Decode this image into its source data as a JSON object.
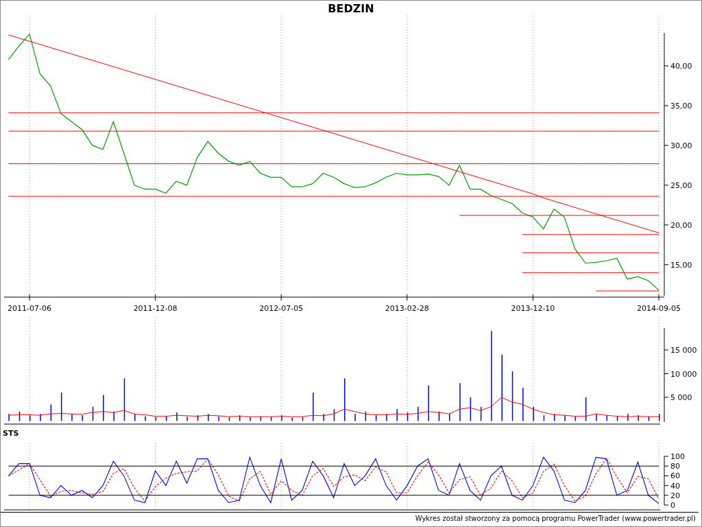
{
  "title": "BEDZIN",
  "price_chart": {
    "chart_data": {
      "type": "line",
      "categories": [
        null,
        null,
        "2011-07-06",
        null,
        null,
        null,
        null,
        null,
        null,
        null,
        null,
        null,
        null,
        null,
        "2011-12-08",
        null,
        null,
        null,
        null,
        null,
        null,
        null,
        null,
        null,
        null,
        null,
        "2012-07-05",
        null,
        null,
        null,
        null,
        null,
        null,
        null,
        null,
        null,
        null,
        null,
        "2013-02-28",
        null,
        null,
        null,
        null,
        null,
        null,
        null,
        null,
        null,
        null,
        null,
        "2013-12-10",
        null,
        null,
        null,
        null,
        null,
        null,
        null,
        null,
        null,
        null,
        null,
        "2014-09-05"
      ],
      "series": [
        {
          "color": "#00a000",
          "values": [
            40.8,
            42.5,
            44,
            39,
            37.5,
            34,
            33,
            32,
            30,
            29.5,
            33,
            29,
            25,
            24.5,
            24.5,
            24,
            25.5,
            25,
            28.5,
            30.5,
            29,
            28,
            27.5,
            28,
            26.5,
            26,
            26,
            24.8,
            24.8,
            25.2,
            26.5,
            26,
            25.2,
            24.7,
            24.8,
            25.3,
            26,
            26.5,
            26.3,
            26.3,
            26.4,
            26.1,
            25,
            27.5,
            24.5,
            24.5,
            23.7,
            23.2,
            22.7,
            21.5,
            21,
            19.5,
            22,
            21,
            17,
            15.2,
            15.3,
            15.5,
            15.8,
            13.2,
            13.5,
            13,
            11.8
          ]
        },
        {
          "color": "#ff0000",
          "values": [
            43.9,
            43.5,
            43.1,
            42.7,
            42.3,
            41.9,
            41.5,
            41.1,
            40.7,
            40.3,
            39.9,
            39.5,
            39.1,
            38.7,
            38.3,
            37.9,
            37.5,
            37.1,
            36.7,
            36.3,
            35.9,
            35.5,
            35.1,
            34.7,
            34.3,
            33.9,
            33.5,
            33.1,
            32.7,
            32.3,
            31.9,
            31.5,
            31.1,
            30.7,
            30.3,
            29.9,
            29.5,
            29.1,
            28.7,
            28.3,
            27.9,
            27.5,
            27.1,
            26.7,
            26.3,
            25.9,
            25.5,
            25.1,
            24.7,
            24.3,
            23.9,
            23.4,
            23.0,
            22.6,
            22.2,
            21.8,
            21.4,
            21.0,
            20.6,
            20.2,
            19.8,
            19.4,
            19.0
          ]
        },
        {
          "color": "#ff0000",
          "values": [
            34.1,
            34.1,
            34.1,
            34.1,
            34.1,
            34.1,
            34.1,
            34.1,
            34.1,
            34.1,
            34.1,
            34.1,
            34.1,
            34.1,
            34.1,
            34.1,
            34.1,
            34.1,
            34.1,
            34.1,
            34.1,
            34.1,
            34.1,
            34.1,
            34.1,
            34.1,
            34.1,
            34.1,
            34.1,
            34.1,
            34.1,
            34.1,
            34.1,
            34.1,
            34.1,
            34.1,
            34.1,
            34.1,
            34.1,
            34.1,
            34.1,
            34.1,
            34.1,
            34.1,
            34.1,
            34.1,
            34.1,
            34.1,
            34.1,
            34.1,
            34.1,
            34.1,
            34.1,
            34.1,
            34.1,
            34.1,
            34.1,
            34.1,
            34.1,
            34.1,
            34.1,
            34.1,
            34.1
          ]
        },
        {
          "color": "#ff0000",
          "values": [
            31.8,
            31.8,
            31.8,
            31.8,
            31.8,
            31.8,
            31.8,
            31.8,
            31.8,
            31.8,
            31.8,
            31.8,
            31.8,
            31.8,
            31.8,
            31.8,
            31.8,
            31.8,
            31.8,
            31.8,
            31.8,
            31.8,
            31.8,
            31.8,
            31.8,
            31.8,
            31.8,
            31.8,
            31.8,
            31.8,
            31.8,
            31.8,
            31.8,
            31.8,
            31.8,
            31.8,
            31.8,
            31.8,
            31.8,
            31.8,
            31.8,
            31.8,
            31.8,
            31.8,
            31.8,
            31.8,
            31.8,
            31.8,
            31.8,
            31.8,
            31.8,
            31.8,
            31.8,
            31.8,
            31.8,
            31.8,
            31.8,
            31.8,
            31.8,
            31.8,
            31.8,
            31.8,
            31.8
          ]
        },
        {
          "color": "#ff0000",
          "values": [
            27.7,
            27.7,
            27.7,
            27.7,
            27.7,
            27.7,
            27.7,
            27.7,
            27.7,
            27.7,
            27.7,
            27.7,
            27.7,
            27.7,
            27.7,
            27.7,
            27.7,
            27.7,
            27.7,
            27.7,
            27.7,
            27.7,
            27.7,
            27.7,
            27.7,
            27.7,
            27.7,
            27.7,
            27.7,
            27.7,
            27.7,
            27.7,
            27.7,
            27.7,
            27.7,
            27.7,
            27.7,
            27.7,
            27.7,
            27.7,
            27.7,
            27.7,
            27.7,
            27.7,
            27.7,
            27.7,
            27.7,
            27.7,
            27.7,
            27.7,
            27.7,
            27.7,
            27.7,
            27.7,
            27.7,
            27.7,
            27.7,
            27.7,
            27.7,
            27.7,
            27.7,
            27.7,
            27.7
          ]
        },
        {
          "color": "#ff0000",
          "values": [
            23.6,
            23.6,
            23.6,
            23.6,
            23.6,
            23.6,
            23.6,
            23.6,
            23.6,
            23.6,
            23.6,
            23.6,
            23.6,
            23.6,
            23.6,
            23.6,
            23.6,
            23.6,
            23.6,
            23.6,
            23.6,
            23.6,
            23.6,
            23.6,
            23.6,
            23.6,
            23.6,
            23.6,
            23.6,
            23.6,
            23.6,
            23.6,
            23.6,
            23.6,
            23.6,
            23.6,
            23.6,
            23.6,
            23.6,
            23.6,
            23.6,
            23.6,
            23.6,
            23.6,
            23.6,
            23.6,
            23.6,
            23.6,
            23.6,
            23.6,
            23.6,
            23.6,
            23.6,
            23.6,
            23.6,
            23.6,
            23.6,
            23.6,
            23.6,
            23.6,
            23.6,
            23.6,
            23.6
          ]
        },
        {
          "color": "#ff0000",
          "values": [
            null,
            null,
            null,
            null,
            null,
            null,
            null,
            null,
            null,
            null,
            null,
            null,
            null,
            null,
            null,
            null,
            null,
            null,
            null,
            null,
            null,
            null,
            null,
            null,
            null,
            null,
            null,
            null,
            null,
            null,
            null,
            null,
            null,
            null,
            null,
            null,
            null,
            null,
            null,
            null,
            null,
            null,
            null,
            21.2,
            21.2,
            21.2,
            21.2,
            21.2,
            21.2,
            21.2,
            21.2,
            21.2,
            21.2,
            21.2,
            21.2,
            21.2,
            21.2,
            21.2,
            21.2,
            21.2,
            21.2,
            21.2,
            21.2
          ]
        },
        {
          "color": "#ff0000",
          "values": [
            null,
            null,
            null,
            null,
            null,
            null,
            null,
            null,
            null,
            null,
            null,
            null,
            null,
            null,
            null,
            null,
            null,
            null,
            null,
            null,
            null,
            null,
            null,
            null,
            null,
            null,
            null,
            null,
            null,
            null,
            null,
            null,
            null,
            null,
            null,
            null,
            null,
            null,
            null,
            null,
            null,
            null,
            null,
            null,
            null,
            null,
            null,
            null,
            null,
            18.8,
            18.8,
            18.8,
            18.8,
            18.8,
            18.8,
            18.8,
            18.8,
            18.8,
            18.8,
            18.8,
            18.8,
            18.8,
            18.8
          ]
        },
        {
          "color": "#ff0000",
          "values": [
            null,
            null,
            null,
            null,
            null,
            null,
            null,
            null,
            null,
            null,
            null,
            null,
            null,
            null,
            null,
            null,
            null,
            null,
            null,
            null,
            null,
            null,
            null,
            null,
            null,
            null,
            null,
            null,
            null,
            null,
            null,
            null,
            null,
            null,
            null,
            null,
            null,
            null,
            null,
            null,
            null,
            null,
            null,
            null,
            null,
            null,
            null,
            null,
            null,
            16.5,
            16.5,
            16.5,
            16.5,
            16.5,
            16.5,
            16.5,
            16.5,
            16.5,
            16.5,
            16.5,
            16.5,
            16.5,
            16.5
          ]
        },
        {
          "color": "#ff0000",
          "values": [
            null,
            null,
            null,
            null,
            null,
            null,
            null,
            null,
            null,
            null,
            null,
            null,
            null,
            null,
            null,
            null,
            null,
            null,
            null,
            null,
            null,
            null,
            null,
            null,
            null,
            null,
            null,
            null,
            null,
            null,
            null,
            null,
            null,
            null,
            null,
            null,
            null,
            null,
            null,
            null,
            null,
            null,
            null,
            null,
            null,
            null,
            null,
            null,
            null,
            14.0,
            14.0,
            14.0,
            14.0,
            14.0,
            14.0,
            14.0,
            14.0,
            14.0,
            14.0,
            14.0,
            14.0,
            14.0,
            14.0
          ]
        },
        {
          "color": "#ff0000",
          "values": [
            null,
            null,
            null,
            null,
            null,
            null,
            null,
            null,
            null,
            null,
            null,
            null,
            null,
            null,
            null,
            null,
            null,
            null,
            null,
            null,
            null,
            null,
            null,
            null,
            null,
            null,
            null,
            null,
            null,
            null,
            null,
            null,
            null,
            null,
            null,
            null,
            null,
            null,
            null,
            null,
            null,
            null,
            null,
            null,
            null,
            null,
            null,
            null,
            null,
            null,
            null,
            null,
            null,
            null,
            null,
            null,
            11.7,
            11.7,
            11.7,
            11.7,
            11.7,
            11.7,
            11.7
          ]
        }
      ],
      "ylim": [
        11.1,
        46.3
      ],
      "yticks": [
        {
          "value": 15,
          "label": "15,00"
        },
        {
          "value": 20,
          "label": "20,00"
        },
        {
          "value": 25,
          "label": "25,00"
        },
        {
          "value": 30,
          "label": "30,00"
        },
        {
          "value": 35,
          "label": "35,00"
        },
        {
          "value": 40,
          "label": "40,00"
        }
      ],
      "grid": true
    }
  },
  "volume_chart": {
    "chart_data": {
      "type": "bar",
      "categories": [
        null,
        null,
        null,
        null,
        null,
        null,
        null,
        null,
        null,
        null,
        null,
        null,
        null,
        null,
        null,
        null,
        null,
        null,
        null,
        null,
        null,
        null,
        null,
        null,
        null,
        null,
        null,
        null,
        null,
        null,
        null,
        null,
        null,
        null,
        null,
        null,
        null,
        null,
        null,
        null,
        null,
        null,
        null,
        null,
        null,
        null,
        null,
        null,
        null,
        null,
        null,
        null,
        null,
        null,
        null,
        null,
        null,
        null,
        null,
        null,
        null,
        null,
        null
      ],
      "series": [
        {
          "color": "#0000ff",
          "values": [
            1500,
            2000,
            1200,
            1500,
            3500,
            6000,
            1500,
            1200,
            3000,
            5500,
            2000,
            9000,
            1500,
            1000,
            800,
            1000,
            1800,
            900,
            1200,
            1500,
            1000,
            800,
            1200,
            800,
            1000,
            900,
            1200,
            700,
            900,
            6000,
            1500,
            2500,
            9000,
            1500,
            2000,
            1200,
            1500,
            2500,
            1800,
            3000,
            7500,
            2000,
            1500,
            8000,
            5000,
            3000,
            19000,
            14000,
            10500,
            7000,
            3000,
            1200,
            1500,
            1200,
            1000,
            5000,
            1500,
            1200,
            1000,
            1500,
            1200,
            1000,
            1500
          ]
        },
        {
          "type": "line",
          "color": "#ff0000",
          "values": [
            1200,
            1300,
            1300,
            1200,
            1500,
            1600,
            1500,
            1400,
            1800,
            2000,
            1800,
            2200,
            1500,
            1300,
            1000,
            1000,
            1200,
            1100,
            1000,
            1200,
            1100,
            900,
            1000,
            900,
            900,
            900,
            1000,
            900,
            900,
            1200,
            1100,
            1500,
            2500,
            2000,
            1500,
            1300,
            1300,
            1500,
            1400,
            1600,
            2000,
            1800,
            1500,
            2500,
            2800,
            2200,
            3000,
            5000,
            4000,
            3500,
            2500,
            1800,
            1300,
            1200,
            1000,
            1000,
            1500,
            1200,
            1000,
            900,
            1000,
            900,
            900
          ]
        }
      ],
      "ylim": [
        0,
        20000
      ],
      "grid": true,
      "yticks": [
        {
          "value": 5000,
          "label": "5 000"
        },
        {
          "value": 10000,
          "label": "10 000"
        },
        {
          "value": 15000,
          "label": "15 000"
        }
      ]
    }
  },
  "sts_chart": {
    "label": "STS",
    "chart_data": {
      "type": "line",
      "categories": [
        null,
        null,
        null,
        null,
        null,
        null,
        null,
        null,
        null,
        null,
        null,
        null,
        null,
        null,
        null,
        null,
        null,
        null,
        null,
        null,
        null,
        null,
        null,
        null,
        null,
        null,
        null,
        null,
        null,
        null,
        null,
        null,
        null,
        null,
        null,
        null,
        null,
        null,
        null,
        null,
        null,
        null,
        null,
        null,
        null,
        null,
        null,
        null,
        null,
        null,
        null,
        null,
        null,
        null,
        null,
        null,
        null,
        null,
        null,
        null,
        null,
        null,
        null
      ],
      "series": [
        {
          "color": "#0000ff",
          "values": [
            60,
            85,
            85,
            20,
            15,
            40,
            20,
            30,
            15,
            40,
            90,
            60,
            10,
            5,
            70,
            40,
            90,
            45,
            95,
            95,
            30,
            5,
            10,
            98,
            40,
            5,
            95,
            10,
            30,
            90,
            60,
            15,
            85,
            40,
            60,
            95,
            40,
            10,
            40,
            80,
            95,
            30,
            20,
            85,
            30,
            10,
            60,
            80,
            20,
            10,
            40,
            98,
            70,
            10,
            5,
            30,
            98,
            95,
            20,
            30,
            88,
            20,
            3
          ]
        },
        {
          "color": "#ff0000",
          "line_style": "dashed",
          "values": [
            60,
            72,
            85,
            52,
            18,
            28,
            30,
            25,
            22,
            28,
            65,
            75,
            35,
            8,
            38,
            55,
            65,
            68,
            70,
            95,
            62,
            18,
            8,
            54,
            69,
            22,
            50,
            30,
            20,
            60,
            75,
            38,
            58,
            62,
            50,
            78,
            68,
            25,
            25,
            60,
            88,
            62,
            25,
            52,
            58,
            20,
            35,
            70,
            50,
            15,
            25,
            69,
            84,
            40,
            8,
            18,
            64,
            96,
            58,
            25,
            59,
            54,
            12
          ]
        },
        {
          "color": "#000000",
          "values": [
            80,
            80,
            80,
            80,
            80,
            80,
            80,
            80,
            80,
            80,
            80,
            80,
            80,
            80,
            80,
            80,
            80,
            80,
            80,
            80,
            80,
            80,
            80,
            80,
            80,
            80,
            80,
            80,
            80,
            80,
            80,
            80,
            80,
            80,
            80,
            80,
            80,
            80,
            80,
            80,
            80,
            80,
            80,
            80,
            80,
            80,
            80,
            80,
            80,
            80,
            80,
            80,
            80,
            80,
            80,
            80,
            80,
            80,
            80,
            80,
            80,
            80,
            80
          ]
        },
        {
          "color": "#000000",
          "values": [
            20,
            20,
            20,
            20,
            20,
            20,
            20,
            20,
            20,
            20,
            20,
            20,
            20,
            20,
            20,
            20,
            20,
            20,
            20,
            20,
            20,
            20,
            20,
            20,
            20,
            20,
            20,
            20,
            20,
            20,
            20,
            20,
            20,
            20,
            20,
            20,
            20,
            20,
            20,
            20,
            20,
            20,
            20,
            20,
            20,
            20,
            20,
            20,
            20,
            20,
            20,
            20,
            20,
            20,
            20,
            20,
            20,
            20,
            20,
            20,
            20,
            20,
            20
          ]
        }
      ],
      "ylim": [
        0,
        100
      ],
      "yticks": [
        {
          "value": 0,
          "label": "0"
        },
        {
          "value": 20,
          "label": "20"
        },
        {
          "value": 40,
          "label": "40"
        },
        {
          "value": 60,
          "label": "60"
        },
        {
          "value": 80,
          "label": "80"
        },
        {
          "value": 100,
          "label": "100"
        }
      ],
      "grid": true
    }
  },
  "footer": "Wykres został stworzony za pomocą programu PowerTrader (www.powertrader.pl)"
}
